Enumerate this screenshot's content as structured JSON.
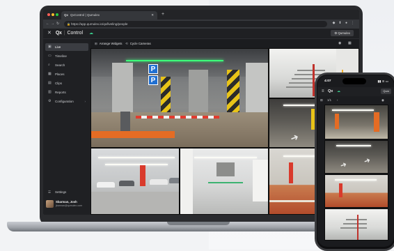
{
  "browser": {
    "tab_title": "QxControl | Qumulex",
    "tab_favicon": "Qx",
    "url": "https://app.qumulex.io/qx/liveling/people"
  },
  "app": {
    "logo_mark": "Qx",
    "logo_text": "Control",
    "org_button": "Qumulex",
    "accent_color": "#39c98a"
  },
  "sidebar": {
    "items": [
      {
        "label": "Live",
        "icon": "live-icon"
      },
      {
        "label": "Timeline",
        "icon": "timeline-icon"
      },
      {
        "label": "Search",
        "icon": "search-icon"
      },
      {
        "label": "Places",
        "icon": "places-icon"
      },
      {
        "label": "Clips",
        "icon": "clips-icon"
      },
      {
        "label": "Reports",
        "icon": "reports-icon"
      },
      {
        "label": "Configuration",
        "icon": "gear-icon"
      }
    ],
    "settings_label": "Settings",
    "profile": {
      "name": "Sbarman, Josh",
      "email": "jbarman@qumulex.com"
    }
  },
  "toolbar": {
    "arrange_label": "Arrange Widgets",
    "cycle_label": "Cycle Cameras"
  },
  "phone": {
    "time": "4:07",
    "toolbar_value": "1/1",
    "org_button": "Qum"
  }
}
